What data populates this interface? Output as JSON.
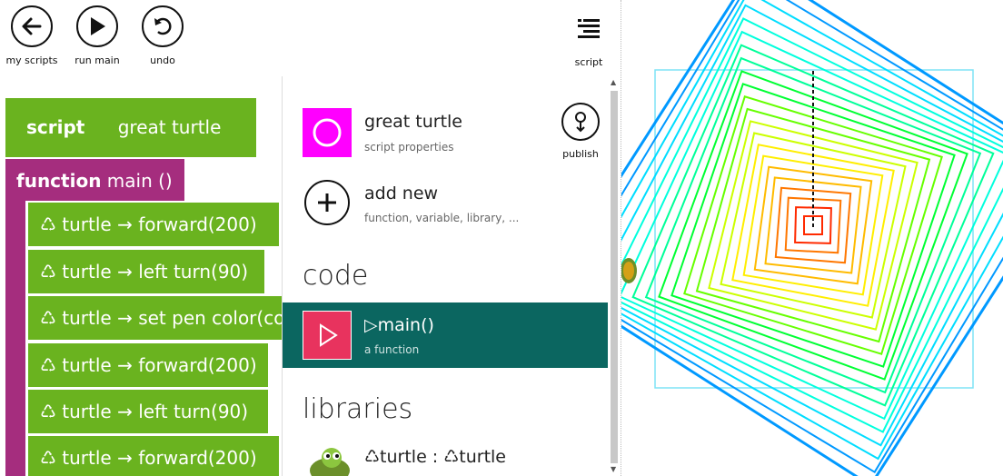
{
  "toolbar": {
    "my_scripts": "my scripts",
    "run_main": "run main",
    "undo": "undo",
    "script": "script"
  },
  "editor": {
    "script_keyword": "script",
    "script_name": "great turtle",
    "function_keyword": "function",
    "function_signature": "main ()",
    "statements": [
      "♺ turtle → forward(200)",
      "♺ turtle → left turn(90)",
      "♺ turtle → set pen color(co",
      "♺ turtle → forward(200)",
      "♺ turtle → left turn(90)",
      "♺ turtle → forward(200)"
    ]
  },
  "panel": {
    "script_item": {
      "title": "great turtle",
      "subtitle": "script properties",
      "color": "#ff00ff"
    },
    "publish_label": "publish",
    "add_new": {
      "title": "add new",
      "subtitle": "function, variable, library, ..."
    },
    "code_heading": "code",
    "main_item": {
      "title": "▷main()",
      "subtitle": "a function",
      "bg": "#0b6660",
      "icon_bg": "#e8335e"
    },
    "libraries_heading": "libraries",
    "library_item": {
      "title": "♺turtle : ♺turtle"
    }
  },
  "canvas": {
    "colors": [
      "#ff3300",
      "#ff7700",
      "#ffbb00",
      "#ffee00",
      "#ccff00",
      "#66ff00",
      "#00ff33",
      "#00ff99",
      "#00ffdd",
      "#00ddff",
      "#0099ff"
    ]
  }
}
